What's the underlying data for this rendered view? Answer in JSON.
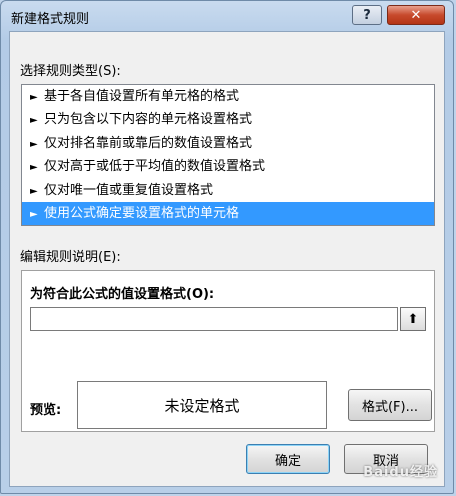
{
  "dialog": {
    "title": "新建格式规则",
    "help_label": "?",
    "close_label": "✕"
  },
  "rule_type": {
    "label": "选择规则类型(S):",
    "items": [
      {
        "label": "基于各自值设置所有单元格的格式",
        "selected": false
      },
      {
        "label": "只为包含以下内容的单元格设置格式",
        "selected": false
      },
      {
        "label": "仅对排名靠前或靠后的数值设置格式",
        "selected": false
      },
      {
        "label": "仅对高于或低于平均值的数值设置格式",
        "selected": false
      },
      {
        "label": "仅对唯一值或重复值设置格式",
        "selected": false
      },
      {
        "label": "使用公式确定要设置格式的单元格",
        "selected": true
      }
    ],
    "arrow_glyph": "►"
  },
  "rule_desc": {
    "label": "编辑规则说明(E):",
    "formula_label": "为符合此公式的值设置格式(O):",
    "formula_value": "",
    "collapse_icon": "collapse-dialog-icon",
    "collapse_glyph": "⬆",
    "preview_label": "预览:",
    "preview_text": "未设定格式",
    "format_button": "格式(F)..."
  },
  "buttons": {
    "ok": "确定",
    "cancel": "取消"
  },
  "watermark": "Baidu经验",
  "colors": {
    "selection": "#3399ff",
    "close": "#c74a2c"
  }
}
